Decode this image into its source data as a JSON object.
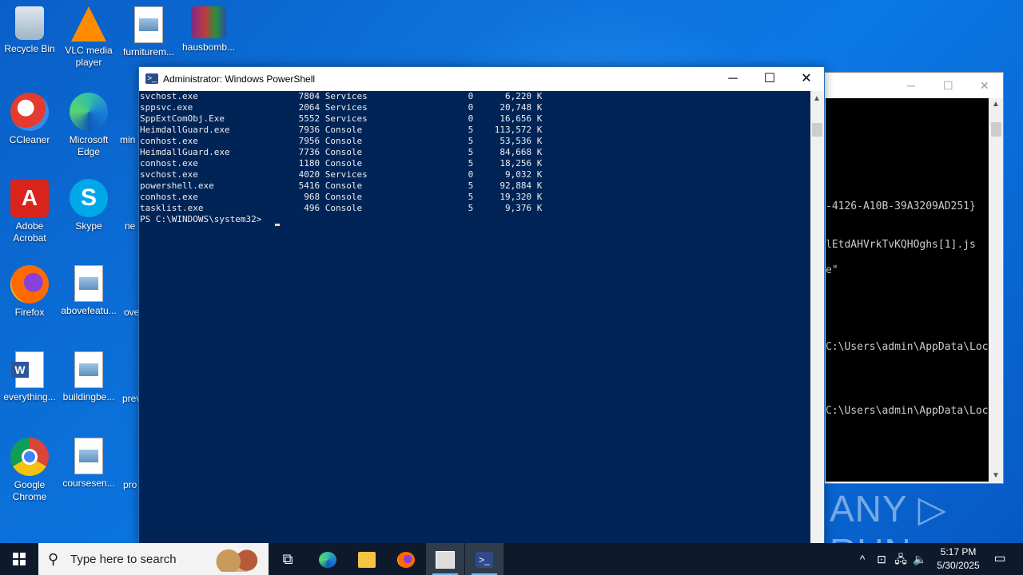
{
  "desktop": {
    "icons": [
      {
        "label": "Recycle Bin",
        "icon": "recycle-bin-icon"
      },
      {
        "label": "VLC media player",
        "icon": "vlc-icon"
      },
      {
        "label": "furniturem...",
        "icon": "image-file-icon"
      },
      {
        "label": "hausbomb...",
        "icon": "winrar-icon"
      },
      {
        "label": "CCleaner",
        "icon": "ccleaner-icon"
      },
      {
        "label": "Microsoft Edge",
        "icon": "edge-icon"
      },
      {
        "label": "min",
        "icon": "word-file-icon"
      },
      {
        "label": "Adobe Acrobat",
        "icon": "acrobat-icon"
      },
      {
        "label": "Skype",
        "icon": "skype-icon"
      },
      {
        "label": "ne",
        "icon": "word-file-icon"
      },
      {
        "label": "Firefox",
        "icon": "firefox-icon"
      },
      {
        "label": "abovefeatu...",
        "icon": "image-file-icon"
      },
      {
        "label": "ove",
        "icon": "word-file-icon"
      },
      {
        "label": "everything...",
        "icon": "word-file-icon"
      },
      {
        "label": "buildingbe...",
        "icon": "image-file-icon"
      },
      {
        "label": "prev",
        "icon": "word-file-icon"
      },
      {
        "label": "Google Chrome",
        "icon": "chrome-icon"
      },
      {
        "label": "coursesen...",
        "icon": "image-file-icon"
      },
      {
        "label": "pro",
        "icon": "word-file-icon"
      }
    ]
  },
  "back_window": {
    "lines": [
      "-4126-A10B-39A3209AD251}",
      "lEtdAHVrkTvKQHOghs[1].js",
      "e\"",
      "C:\\Users\\admin\\AppData\\Loc",
      "C:\\Users\\admin\\AppData\\Loc"
    ],
    "minimize": "─",
    "maximize": "☐",
    "close": "✕"
  },
  "powershell": {
    "title": "Administrator: Windows PowerShell",
    "minimize": "─",
    "maximize": "☐",
    "close": "✕",
    "lines": [
      "svchost.exe                   7804 Services                   0      6,220 K",
      "sppsvc.exe                    2064 Services                   0     20,748 K",
      "SppExtComObj.Exe              5552 Services                   0     16,656 K",
      "HeimdallGuard.exe             7936 Console                    5    113,572 K",
      "conhost.exe                   7956 Console                    5     53,536 K",
      "HeimdallGuard.exe             7736 Console                    5     84,668 K",
      "conhost.exe                   1180 Console                    5     18,256 K",
      "svchost.exe                   4020 Services                   0      9,032 K",
      "powershell.exe                5416 Console                    5     92,884 K",
      "conhost.exe                    968 Console                    5     19,320 K",
      "tasklist.exe                   496 Console                    5      9,376 K",
      "PS C:\\WINDOWS\\system32> "
    ]
  },
  "watermark": "ANY ▷ RUN",
  "taskbar": {
    "search_placeholder": "Type here to search",
    "time": "5:17 PM",
    "date": "5/30/2025",
    "tray_chevron": "^",
    "notification": "▭"
  }
}
